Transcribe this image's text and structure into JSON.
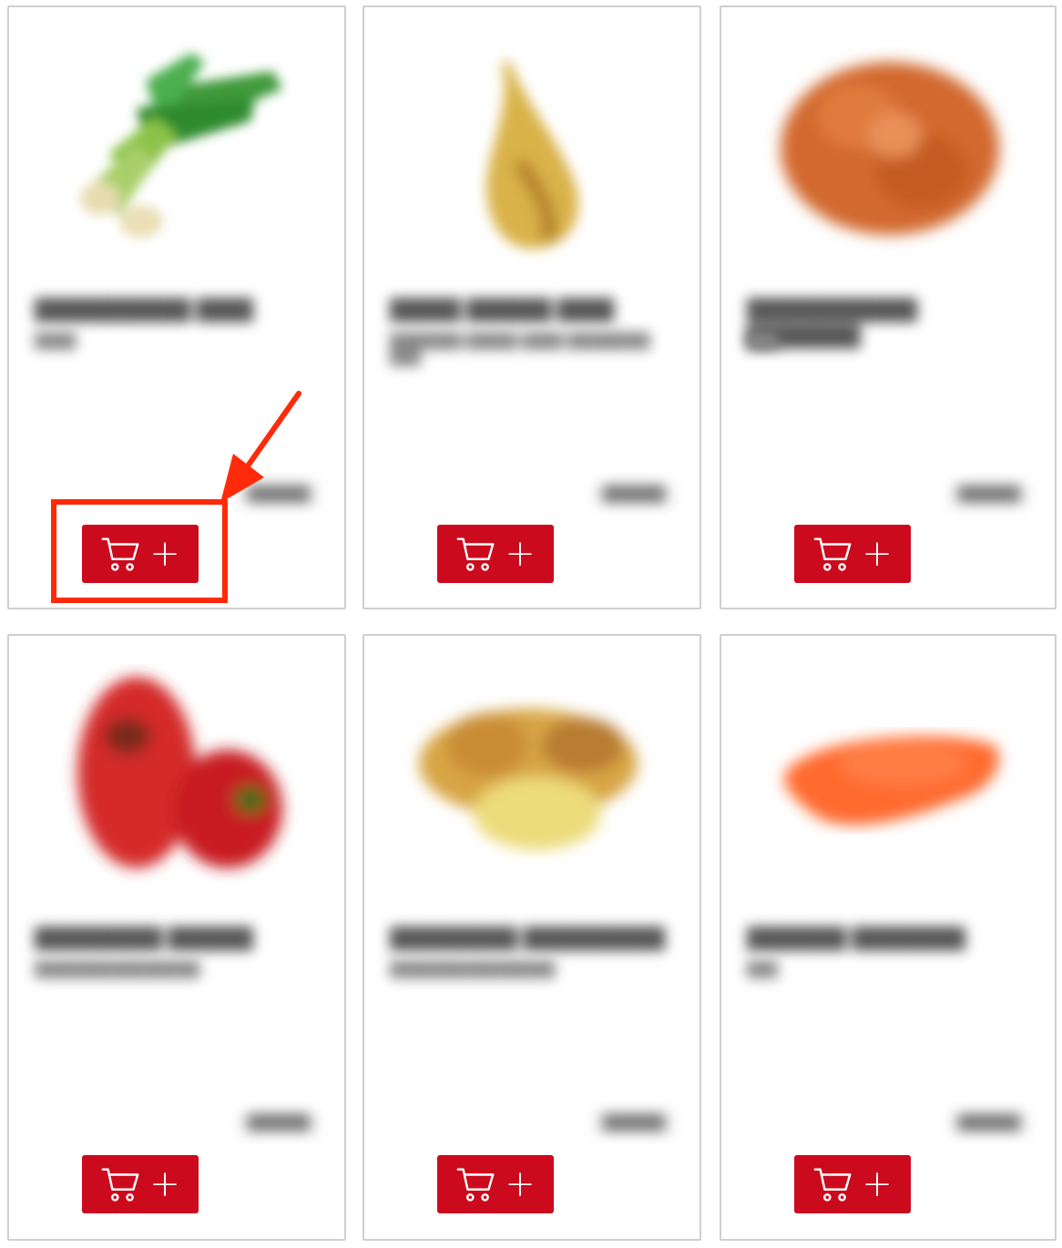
{
  "products": [
    {
      "image": "spring-onion",
      "add_label": "+"
    },
    {
      "image": "pear",
      "add_label": "+"
    },
    {
      "image": "shallots",
      "add_label": "+"
    },
    {
      "image": "red-peppers",
      "add_label": "+"
    },
    {
      "image": "ginger",
      "add_label": "+"
    },
    {
      "image": "carrot",
      "add_label": "+"
    }
  ],
  "colors": {
    "button": "#cc0a1e",
    "annotation": "#ff2a0a",
    "card_border": "#cfcfcf"
  },
  "icons": {
    "cart": "cart-icon",
    "annotation_arrow": "arrow-icon"
  }
}
